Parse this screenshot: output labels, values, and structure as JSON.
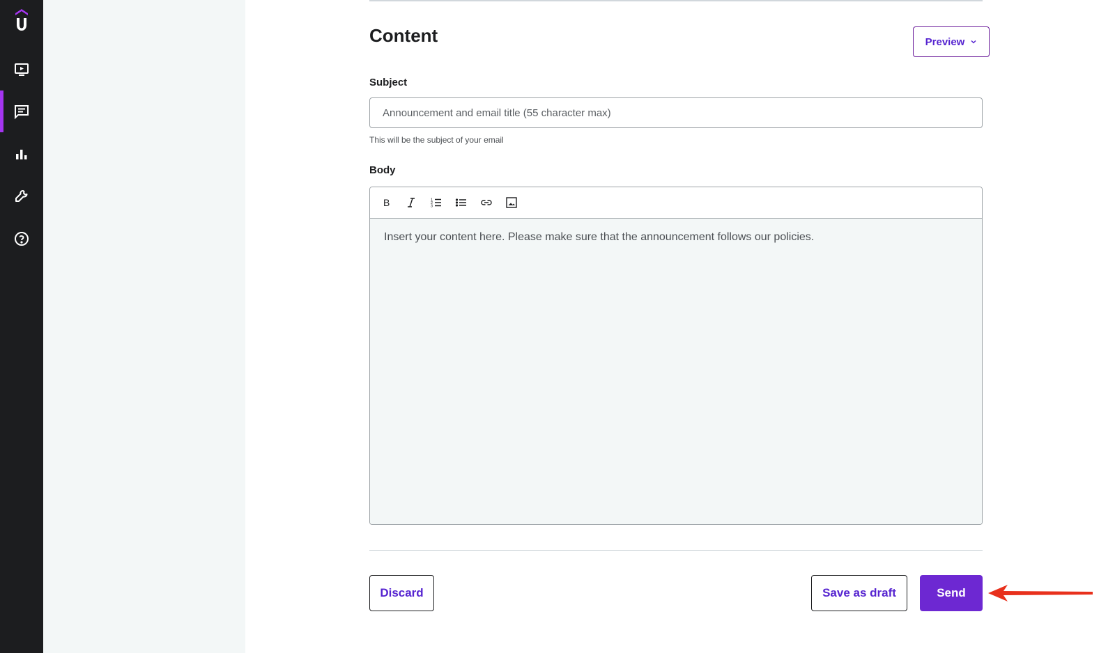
{
  "sidebar": {
    "logo_icon": "udemy-logo-icon",
    "items": [
      {
        "icon": "course-video-icon",
        "active": false
      },
      {
        "icon": "communication-chat-icon",
        "active": true
      },
      {
        "icon": "performance-bar-chart-icon",
        "active": false
      },
      {
        "icon": "tools-wrench-icon",
        "active": false
      },
      {
        "icon": "help-question-icon",
        "active": false
      }
    ]
  },
  "content": {
    "title": "Content",
    "preview_label": "Preview",
    "subject": {
      "label": "Subject",
      "placeholder": "Announcement and email title (55 character max)",
      "value": "",
      "helper": "This will be the subject of your email"
    },
    "body": {
      "label": "Body",
      "toolbar": [
        "bold-icon",
        "italic-icon",
        "ordered-list-icon",
        "bullet-list-icon",
        "link-icon",
        "image-icon"
      ],
      "placeholder": "Insert your content here. Please make sure that the announcement follows our policies."
    }
  },
  "actions": {
    "discard_label": "Discard",
    "draft_label": "Save as draft",
    "send_label": "Send"
  },
  "colors": {
    "rail_bg": "#1c1d1f",
    "active_accent": "#a435f0",
    "primary_purple": "#6d28d2",
    "link_purple": "#5624d0",
    "annotation_arrow": "#e8301c"
  }
}
